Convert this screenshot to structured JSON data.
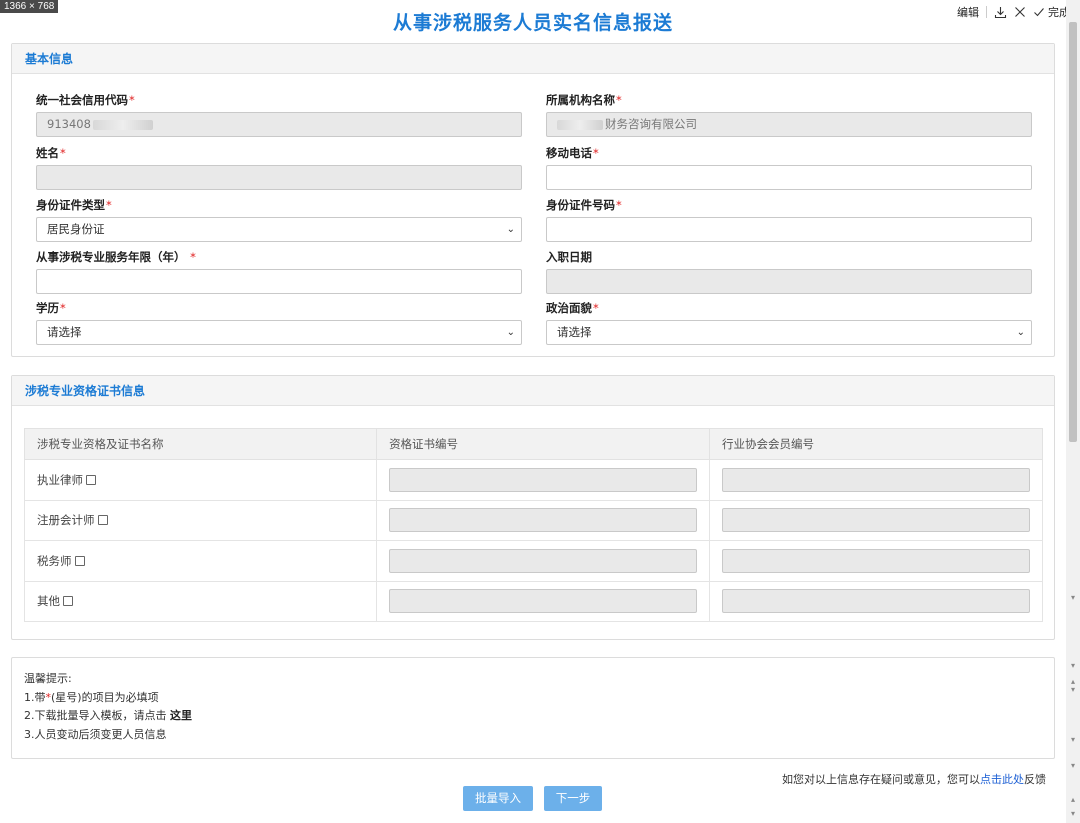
{
  "size_badge": "1366 × 768",
  "title": "从事涉税服务人员实名信息报送",
  "toolbar": {
    "edit": "编辑",
    "done": "完成"
  },
  "basic": {
    "heading": "基本信息",
    "credit_code": {
      "label": "统一社会信用代码",
      "value": "913408"
    },
    "org_name": {
      "label": "所属机构名称",
      "value": "财务咨询有限公司"
    },
    "name": {
      "label": "姓名",
      "value": ""
    },
    "mobile": {
      "label": "移动电话",
      "value": ""
    },
    "id_type": {
      "label": "身份证件类型",
      "value": "居民身份证"
    },
    "id_number": {
      "label": "身份证件号码",
      "value": ""
    },
    "years": {
      "label": "从事涉税专业服务年限（年）",
      "value": ""
    },
    "entry_date": {
      "label": "入职日期",
      "value": ""
    },
    "education": {
      "label": "学历",
      "value": "请选择"
    },
    "political": {
      "label": "政治面貌",
      "value": "请选择"
    }
  },
  "cert": {
    "heading": "涉税专业资格证书信息",
    "columns": [
      "涉税专业资格及证书名称",
      "资格证书编号",
      "行业协会会员编号"
    ],
    "rows": [
      {
        "name": "执业律师"
      },
      {
        "name": "注册会计师"
      },
      {
        "name": "税务师"
      },
      {
        "name": "其他"
      }
    ]
  },
  "tips": {
    "title": "温馨提示:",
    "line1_prefix": "1.带",
    "line1_star": "*",
    "line1_suffix": "(星号)的项目为必填项",
    "line2_prefix": "2.下载批量导入模板，请点击",
    "line2_link": "这里",
    "line3": "3.人员变动后须变更人员信息"
  },
  "feedback": {
    "prefix": "如您对以上信息存在疑问或意见，您可以",
    "link": "点击此处",
    "suffix": "反馈"
  },
  "buttons": {
    "import": "批量导入",
    "next": "下一步"
  },
  "colors": {
    "accent": "#1c7bd4",
    "button": "#6cb0ea",
    "required": "#e02020"
  }
}
